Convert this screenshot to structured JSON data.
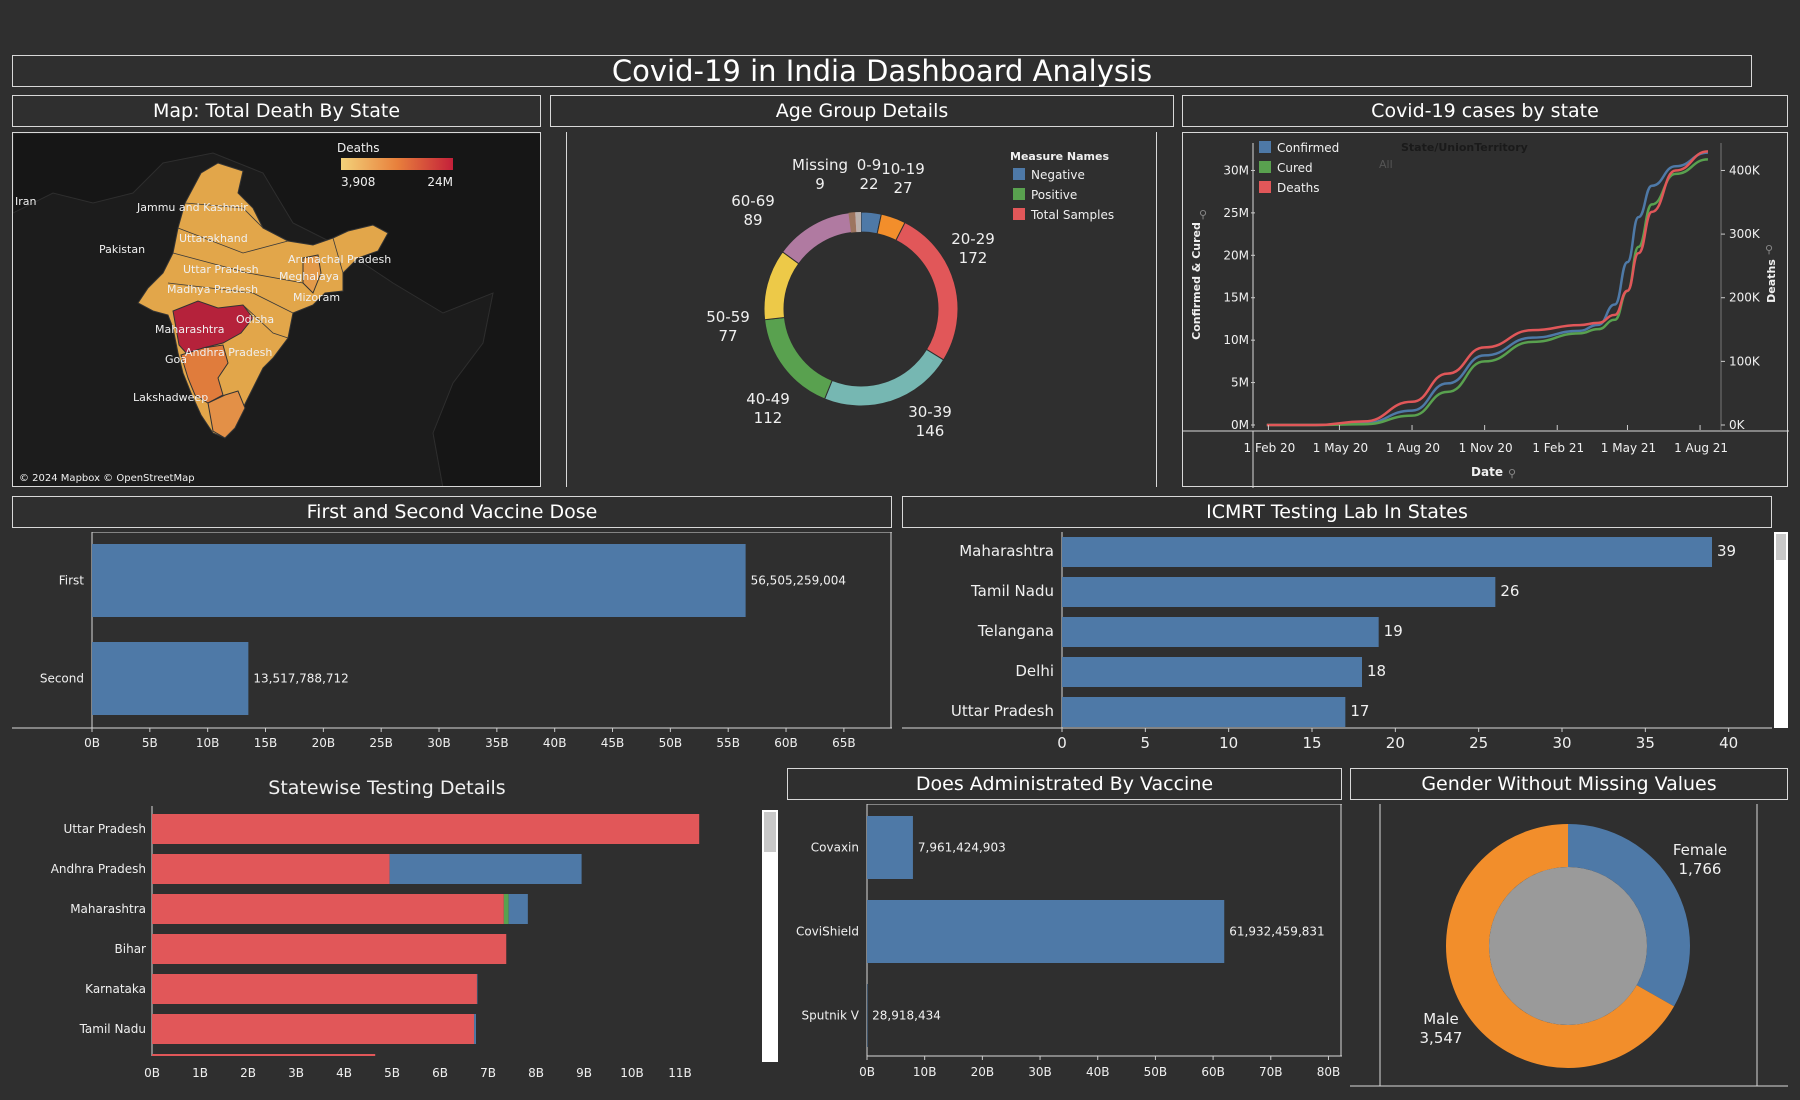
{
  "dashboard": {
    "title": "Covid-19 in India Dashboard Analysis"
  },
  "colors": {
    "blue": "#4e79a7",
    "green": "#59a14f",
    "red": "#e15759",
    "orange": "#f28e2b",
    "teal": "#76b7b2",
    "yellow": "#edc948",
    "purple": "#b07aa1",
    "pink": "#ff9da7",
    "brown": "#9c755f",
    "grey": "#bab0ac",
    "panel_bg": "#2f2f2f"
  },
  "map": {
    "title": "Map: Total Death By State",
    "legend_title": "Deaths",
    "legend_min": "3,908",
    "legend_max": "24M",
    "attribution": "© 2024 Mapbox © OpenStreetMap",
    "labels": [
      "Iran",
      "Jammu and Kashmir",
      "Pakistan",
      "Uttarakhand",
      "Arunachal Pradesh",
      "Uttar Pradesh",
      "Meghalaya",
      "Madhya Pradesh",
      "Mizoram",
      "Odisha",
      "Maharashtra",
      "Goa",
      "Andhra Pradesh",
      "Lakshadweep"
    ]
  },
  "age": {
    "title": "Age Group Details",
    "legend_title": "Measure Names",
    "legend": [
      "Negative",
      "Positive",
      "Total Samples"
    ],
    "labels": [
      "0-9",
      "10-19",
      "20-29",
      "30-39",
      "40-49",
      "50-59",
      "60-69",
      "Missing"
    ],
    "values": [
      "22",
      "27",
      "172",
      "146",
      "112",
      "77",
      "89",
      "9"
    ]
  },
  "cases": {
    "title": "Covid-19 cases by state",
    "legend": [
      "Confirmed",
      "Cured",
      "Deaths"
    ],
    "filter_label": "State/UnionTerritory",
    "filter_value": "All",
    "y_left_title": "Confirmed & Cured",
    "y_right_title": "Deaths",
    "x_title": "Date",
    "y_left_ticks": [
      "0M",
      "5M",
      "10M",
      "15M",
      "20M",
      "25M",
      "30M"
    ],
    "y_right_ticks": [
      "0K",
      "100K",
      "200K",
      "300K",
      "400K"
    ],
    "x_ticks": [
      "1 Feb 20",
      "1 May 20",
      "1 Aug 20",
      "1 Nov 20",
      "1 Feb 21",
      "1 May 21",
      "1 Aug 21"
    ]
  },
  "vaccine_dose": {
    "title": "First and Second Vaccine Dose",
    "categories": [
      "First",
      "Second"
    ],
    "value_labels": [
      "56,505,259,004",
      "13,517,788,712"
    ],
    "x_ticks": [
      "0B",
      "5B",
      "10B",
      "15B",
      "20B",
      "25B",
      "30B",
      "35B",
      "40B",
      "45B",
      "50B",
      "55B",
      "60B",
      "65B"
    ]
  },
  "icmr": {
    "title": "ICMRT Testing Lab In States",
    "categories": [
      "Maharashtra",
      "Tamil Nadu",
      "Telangana",
      "Delhi",
      "Uttar Pradesh"
    ],
    "value_labels": [
      "39",
      "26",
      "19",
      "18",
      "17"
    ],
    "x_ticks": [
      "0",
      "5",
      "10",
      "15",
      "20",
      "25",
      "30",
      "35",
      "40"
    ]
  },
  "statewise": {
    "title": "Statewise Testing Details",
    "categories": [
      "Uttar Pradesh",
      "Andhra Pradesh",
      "Maharashtra",
      "Bihar",
      "Karnataka",
      "Tamil Nadu"
    ],
    "x_ticks": [
      "0B",
      "1B",
      "2B",
      "3B",
      "4B",
      "5B",
      "6B",
      "7B",
      "8B",
      "9B",
      "10B",
      "11B"
    ]
  },
  "by_vaccine": {
    "title": "Does Administrated By Vaccine",
    "categories": [
      "Covaxin",
      "CoviShield",
      "Sputnik V"
    ],
    "value_labels": [
      "7,961,424,903",
      "61,932,459,831",
      "28,918,434"
    ],
    "x_ticks": [
      "0B",
      "10B",
      "20B",
      "30B",
      "40B",
      "50B",
      "60B",
      "70B",
      "80B"
    ]
  },
  "gender": {
    "title": "Gender Without Missing Values",
    "labels": [
      "Female",
      "Male"
    ],
    "values": [
      "1,766",
      "3,547"
    ]
  },
  "chart_data": [
    {
      "type": "pie",
      "title": "Age Group Details",
      "categories": [
        "0-9",
        "10-19",
        "20-29",
        "30-39",
        "40-49",
        "50-59",
        "60-69",
        "Missing"
      ],
      "values": [
        22,
        27,
        172,
        146,
        112,
        77,
        89,
        9
      ]
    },
    {
      "type": "line",
      "title": "Covid-19 cases by state",
      "xlabel": "Date",
      "ylabel": "Confirmed & Cured",
      "y2label": "Deaths",
      "x": [
        "2020-01-30",
        "2020-04-01",
        "2020-06-01",
        "2020-08-01",
        "2020-09-15",
        "2020-11-01",
        "2021-01-01",
        "2021-03-01",
        "2021-03-25",
        "2021-04-15",
        "2021-05-01",
        "2021-05-15",
        "2021-06-01",
        "2021-07-01",
        "2021-08-11"
      ],
      "ylim": [
        0,
        33000000
      ],
      "y2lim": [
        0,
        440000
      ],
      "series": [
        {
          "name": "Confirmed",
          "axis": "left",
          "values": [
            0,
            1800,
            200000,
            1700000,
            4900000,
            8200000,
            10300000,
            11100000,
            11800000,
            14200000,
            19200000,
            24500000,
            28200000,
            30500000,
            32100000
          ]
        },
        {
          "name": "Cured",
          "axis": "left",
          "values": [
            0,
            100,
            90000,
            1100000,
            3900000,
            7500000,
            9800000,
            10800000,
            11300000,
            12400000,
            15800000,
            21000000,
            26000000,
            29600000,
            31300000
          ]
        },
        {
          "name": "Deaths",
          "axis": "right",
          "values": [
            0,
            50,
            5600,
            36500,
            80800,
            122000,
            149000,
            157000,
            160500,
            173000,
            211000,
            270000,
            335000,
            400000,
            430000
          ]
        }
      ]
    },
    {
      "type": "bar",
      "title": "First and Second Vaccine Dose",
      "categories": [
        "First",
        "Second"
      ],
      "values": [
        56505259004,
        13517788712
      ],
      "xlim": [
        0,
        67000000000
      ]
    },
    {
      "type": "bar",
      "title": "ICMRT Testing Lab In States",
      "categories": [
        "Maharashtra",
        "Tamil Nadu",
        "Telangana",
        "Delhi",
        "Uttar Pradesh"
      ],
      "values": [
        39,
        26,
        19,
        18,
        17
      ],
      "xlim": [
        0,
        42
      ]
    },
    {
      "type": "bar",
      "title": "Statewise Testing Details",
      "stacked": true,
      "categories": [
        "Uttar Pradesh",
        "Andhra Pradesh",
        "Maharashtra",
        "Bihar",
        "Karnataka",
        "Tamil Nadu"
      ],
      "xlim": [
        0,
        12000000000
      ],
      "series": [
        {
          "name": "Total Samples",
          "values": [
            11400000000,
            4950000000,
            7330000000,
            7380000000,
            6770000000,
            6710000000
          ]
        },
        {
          "name": "Positive",
          "values": [
            0,
            0,
            100000000,
            0,
            0,
            0
          ]
        },
        {
          "name": "Negative",
          "values": [
            0,
            4000000000,
            400000000,
            0,
            10000000,
            40000000
          ]
        }
      ]
    },
    {
      "type": "bar",
      "title": "Does Administrated By Vaccine",
      "categories": [
        "Covaxin",
        "CoviShield",
        "Sputnik V"
      ],
      "values": [
        7961424903,
        61932459831,
        28918434
      ],
      "xlim": [
        0,
        82000000000
      ]
    },
    {
      "type": "pie",
      "title": "Gender Without Missing Values",
      "categories": [
        "Female",
        "Male"
      ],
      "values": [
        1766,
        3547
      ]
    }
  ]
}
